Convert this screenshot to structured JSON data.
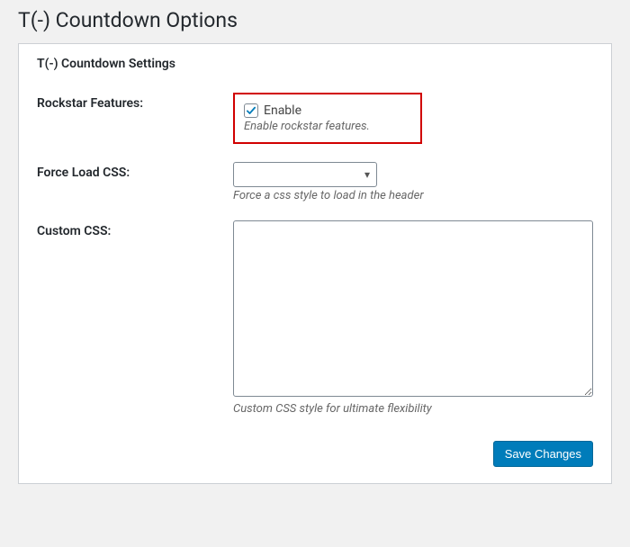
{
  "page": {
    "title": "T(-) Countdown Options"
  },
  "panel": {
    "heading": "T(-) Countdown Settings"
  },
  "fields": {
    "rockstar": {
      "label": "Rockstar Features:",
      "checkbox_label": "Enable",
      "checked": true,
      "description": "Enable rockstar features."
    },
    "force_load_css": {
      "label": "Force Load CSS:",
      "selected": "",
      "description": "Force a css style to load in the header"
    },
    "custom_css": {
      "label": "Custom CSS:",
      "value": "",
      "description": "Custom CSS style for ultimate flexibility"
    }
  },
  "submit": {
    "label": "Save Changes"
  }
}
